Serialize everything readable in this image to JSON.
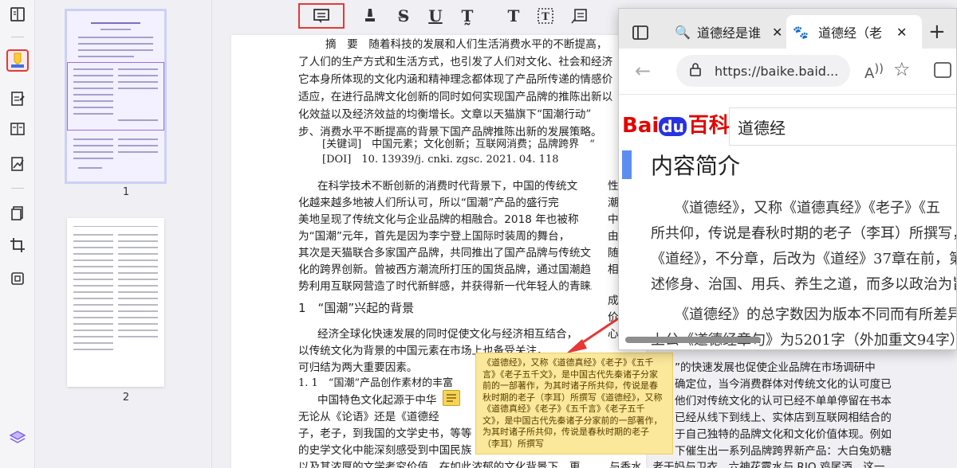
{
  "thumbnails": {
    "page1": "1",
    "page2": "2"
  },
  "document": {
    "abstract_lines": [
      "摘　要　随着科技的发展和人们生活消费水平的不断提高，",
      "了人们的生产方式和生活方式，也引发了人们对文化、社会和经济",
      "它本身所体现的文化内涵和精神理念都体现了产品所传递的情感价",
      "适应，在进行品牌文化创新的同时如何实现国产品牌的推陈出新以",
      "化效益以及经济效益的均衡增长。文章以天猫旗下“国潮行动”",
      "步、消费水平不断提高的背景下国产品牌推陈出新的发展策略。"
    ],
    "keywords": "[关键词]　中国元素；文化创新；互联网消费；品牌跨界　“",
    "doi": "[DOI]　10. 13939/j. cnki. zgsc. 2021. 04. 118",
    "left_col": [
      "在科学技术不断创新的消费时代背景下，中国的传统文",
      "化越来越多地被人们所认可，所以“国潮”产品的盛行完",
      "美地呈现了传统文化与企业品牌的相融合。2018 年也被称",
      "为“国潮”元年，首先是因为李宁登上国际时装周的舞台，",
      "其次是天猫联合多家国产品牌，共同推出了国产品牌与传统文",
      "化的跨界创新。曾被西方潮流所打压的国货品牌，通过国潮趋",
      "势利用互联网营造了时代新鲜感，并获得新一代年轻人的青睐。"
    ],
    "section1": "1　“国潮”兴起的背景",
    "sec1_lines": [
      "经济全球化快速发展的同时促使文化与经济相互结合，",
      "以传统文化为背景的中国元素在市场上也备受关注，"
    ],
    "sec1_end": "可归结为两大重要因素。",
    "subsection": "1. 1　“国潮”产品创作素材的丰富",
    "lower_lines": [
      "中国特色文化起源于中华",
      "无论从《论语》还是《道德经",
      "子，老子，到我国的文学史书，等等",
      "的史学文化中能深刻感受到中国民族",
      "以及其浓厚的文学考究价值。在如此浓郁的文化背景下，更"
    ],
    "right_col_top": [
      "性",
      "潮",
      "中",
      "由",
      "随",
      "相",
      "成",
      "价",
      "心"
    ],
    "right_lines": [
      "”的快速发展也促使企业品牌在市场调研中",
      "确定位，当今消费群体对传统文化的认可度已",
      "他们对传统文化的认可已经不单单停留在书本",
      "已经从线下到线上、实体店到互联网相结合的",
      "于自己独特的品牌文化和文化价值体现。例如",
      "下催生出一系列品牌跨界新产品：大白兔奶糖",
      "与香水，老干妈与卫衣，六神花露水与 RIO 鸡尾酒。这一"
    ]
  },
  "note": {
    "text": "《道德经》，又称《道德真经》《老子》《五千言》《老子五千文》，是中国古代先秦诸子分家前的一部著作，为其时诸子所共仰，传说是春秋时期的老子（李耳）所撰写《道德经》，又称《道德真经》《老子》《五千言》《老子五千文》，是中国古代先秦诸子分家前的一部著作，为其时诸子所共仰，传说是春秋时期的老子（李耳）所撰写"
  },
  "browser": {
    "tab1": "道德经是谁",
    "tab2": "道德经（老",
    "url": "https://baike.baid...",
    "baidu_logo": "Bai",
    "baidu_logo2": "du",
    "baike": "百科",
    "search_value": "道德经",
    "heading": "内容简介",
    "lines": [
      "《道德经》，又称《道德真经》《老子》《五",
      "所共仰，传说是春秋时期的老子（李耳）所撰写，",
      "《道经》，不分章，后改为《道经》37章在前，第",
      "述修身、治国、用兵、养生之道，而多以政治为旨",
      "《道德经》的总字数因为版本不同而有所差异",
      "上公《道德经章句》为5201字（外加重文94字）"
    ]
  },
  "colors": {
    "accent_red": "#e53935",
    "note_yellow": "#fbe89a",
    "baidu_blue": "#2932e1",
    "baidu_red": "#e10601"
  }
}
